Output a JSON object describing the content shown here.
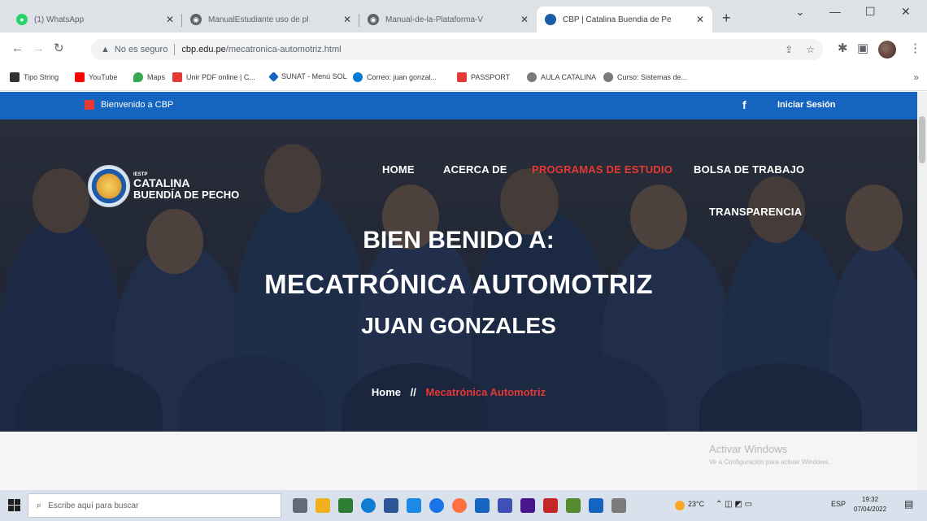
{
  "browser": {
    "tabs": [
      {
        "title": "(1) WhatsApp",
        "active": false,
        "icon": "whatsapp-icon",
        "color": "#25d366"
      },
      {
        "title": "ManualEstudiante uso de pl",
        "active": false,
        "icon": "globe-icon",
        "color": "#5f6368"
      },
      {
        "title": "Manual-de-la-Plataforma-V",
        "active": false,
        "icon": "globe-icon",
        "color": "#5f6368"
      },
      {
        "title": "CBP | Catalina Buendia de Pe",
        "active": true,
        "icon": "cbp-icon",
        "color": "#1e5aa8"
      }
    ],
    "new_tab": "+",
    "window_controls": [
      "—",
      "☐",
      "✕"
    ],
    "address": {
      "security": "No es seguro",
      "host": "cbp.edu.pe",
      "path": "/mecatronica-automotriz.html"
    },
    "bookmarks": [
      {
        "label": "Tipo String",
        "icon": "bookmark-icon",
        "color": "#333333"
      },
      {
        "label": "YouTube",
        "icon": "youtube-icon",
        "color": "#ff0000"
      },
      {
        "label": "Maps",
        "icon": "maps-icon",
        "color": "#34a853"
      },
      {
        "label": "Unir PDF online | C...",
        "icon": "pdf-icon",
        "color": "#e53935"
      },
      {
        "label": "SUNAT - Menú SOL",
        "icon": "sunat-icon",
        "color": "#1565c0"
      },
      {
        "label": "Correo: juan gonzal...",
        "icon": "mail-icon",
        "color": "#0078d4"
      },
      {
        "label": "PASSPORT",
        "icon": "passport-icon",
        "color": "#e53935"
      },
      {
        "label": "AULA CATALINA",
        "icon": "aula-icon",
        "color": "#7a7a7a"
      },
      {
        "label": "Curso: Sistemas de...",
        "icon": "course-icon",
        "color": "#7a7a7a"
      }
    ],
    "bookmarks_more": "»"
  },
  "site": {
    "welcome": "Bienvenido a CBP",
    "facebook": "f",
    "login": "Iniciar Sesión",
    "logo": {
      "small": "IESTP",
      "line1": "CATALINA",
      "line2": "BUENDÍA DE PECHO"
    },
    "nav": [
      {
        "label": "HOME",
        "active": false
      },
      {
        "label": "ACERCA DE",
        "active": false
      },
      {
        "label": "PROGRAMAS DE ESTUDIO",
        "active": true
      },
      {
        "label": "BOLSA DE TRABAJO",
        "active": false
      },
      {
        "label": "TRANSPARENCIA",
        "active": false
      }
    ],
    "hero": {
      "line1": "BIEN BENIDO A:",
      "line2": "MECATRÓNICA AUTOMOTRIZ",
      "line3": "JUAN GONZALES"
    },
    "breadcrumb": {
      "home": "Home",
      "separator": "//",
      "current": "Mecatrónica Automotriz"
    },
    "accent_color": "#e53935",
    "topbar_color": "#1565c0"
  },
  "windows_notice": {
    "title": "Activar Windows",
    "subtitle": "Ve a Configuración para activar Windows."
  },
  "taskbar": {
    "search_placeholder": "Escribe aquí para buscar",
    "weather": "23°C",
    "language": "ESP",
    "time": "19:32",
    "date": "07/04/2022"
  }
}
